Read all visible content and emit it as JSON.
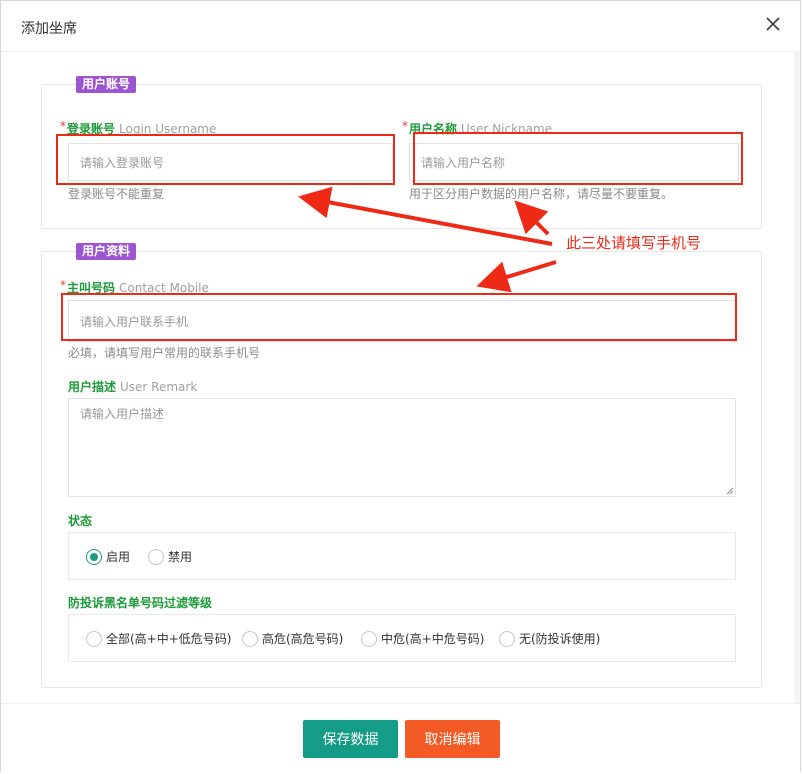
{
  "dialog": {
    "title": "添加坐席",
    "close_icon": "close-icon"
  },
  "sections": {
    "account": {
      "legend": "用户账号"
    },
    "profile": {
      "legend": "用户资料"
    }
  },
  "fields": {
    "username": {
      "required": "*",
      "label_cn": "登录账号",
      "label_en": "Login Username",
      "placeholder": "请输入登录账号",
      "hint": "登录账号不能重复"
    },
    "nickname": {
      "required": "*",
      "label_cn": "用户名称",
      "label_en": "User Nickname",
      "placeholder": "请输入用户名称",
      "hint": "用于区分用户数据的用户名称，请尽量不要重复。"
    },
    "mobile": {
      "required": "*",
      "label_cn": "主叫号码",
      "label_en": "Contact Mobile",
      "placeholder": "请输入用户联系手机",
      "hint": "必填，请填写用户常用的联系手机号"
    },
    "remark": {
      "label_cn": "用户描述",
      "label_en": "User Remark",
      "placeholder": "请输入用户描述"
    },
    "status": {
      "label": "状态",
      "options": [
        {
          "label": "启用",
          "checked": true
        },
        {
          "label": "禁用",
          "checked": false
        }
      ]
    },
    "blacklist": {
      "label": "防投诉黑名单号码过滤等级",
      "options": [
        {
          "label": "全部(高+中+低危号码)",
          "checked": false
        },
        {
          "label": "高危(高危号码)",
          "checked": false
        },
        {
          "label": "中危(高+中危号码)",
          "checked": false
        },
        {
          "label": "无(防投诉使用)",
          "checked": false
        }
      ]
    }
  },
  "annotation": {
    "text": "此三处请填写手机号",
    "color": "#ee2a17"
  },
  "footer": {
    "save_label": "保存数据",
    "cancel_label": "取消编辑"
  },
  "colors": {
    "accent": "#159c86",
    "danger": "#f45a25",
    "legend": "#9b55d1",
    "label": "#1e9b3a"
  }
}
